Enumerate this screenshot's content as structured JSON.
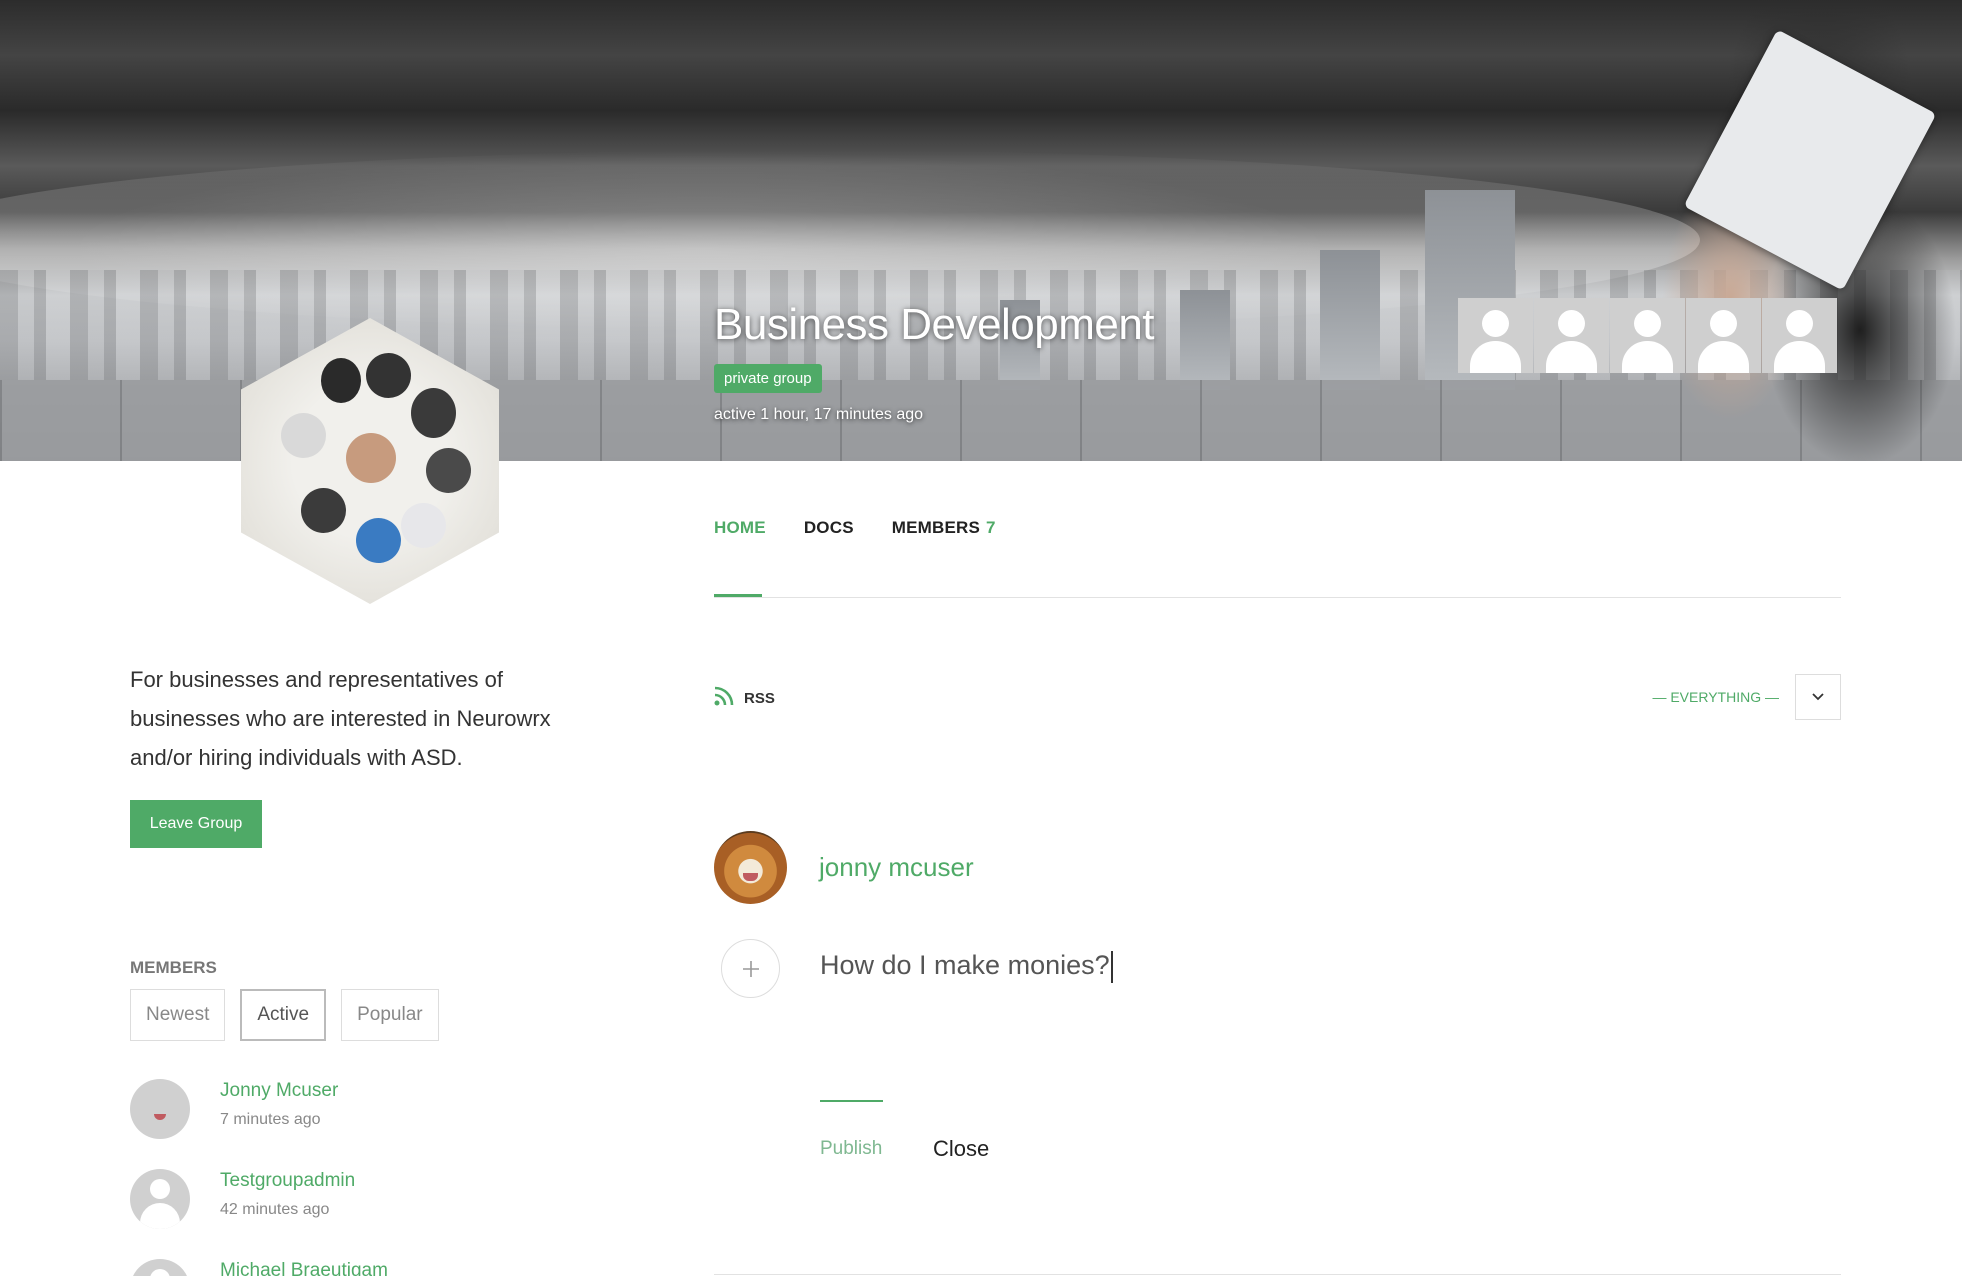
{
  "group": {
    "title": "Business Development",
    "privacy": "private group",
    "activity": "active 1 hour, 17 minutes ago",
    "description": "For businesses and representatives of businesses who are interested in Neurowrx and/or hiring individuals with ASD.",
    "leave_label": "Leave Group"
  },
  "nav": {
    "tabs": [
      {
        "label": "HOME"
      },
      {
        "label": "DOCS"
      },
      {
        "label": "MEMBERS",
        "count": "7"
      }
    ]
  },
  "members_widget": {
    "heading": "MEMBERS",
    "filters": [
      "Newest",
      "Active",
      "Popular"
    ],
    "active_filter": "Active",
    "list": [
      {
        "name": "Jonny Mcuser",
        "time": "7 minutes ago"
      },
      {
        "name": "Testgroupadmin",
        "time": "42 minutes ago"
      },
      {
        "name": "Michael Braeutigam",
        "time": ""
      }
    ]
  },
  "activity": {
    "rss_label": "RSS",
    "filter_value": "— EVERYTHING —",
    "poster_name": "jonny mcuser",
    "post_text": "How do I make monies?",
    "publish_label": "Publish",
    "close_label": "Close"
  },
  "colors": {
    "accent": "#4faa67",
    "text": "#333333",
    "muted": "#888888"
  },
  "icons": {
    "rss": "rss-icon",
    "chevron": "chevron-down-icon",
    "plus": "plus-icon",
    "admin": "user-avatar-icon"
  }
}
